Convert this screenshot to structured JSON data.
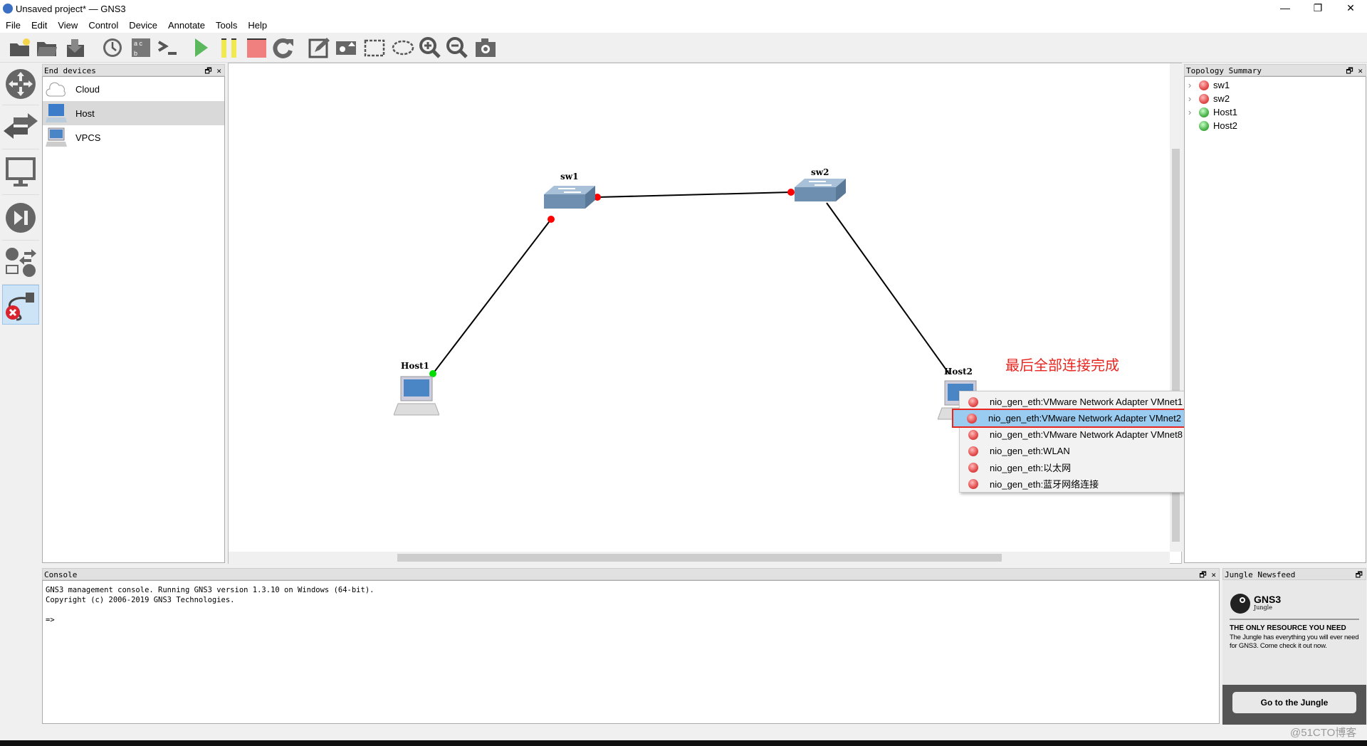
{
  "window": {
    "title": "Unsaved project* — GNS3",
    "minimize": "—",
    "restore": "❐",
    "close": "✕"
  },
  "menu": [
    "File",
    "Edit",
    "View",
    "Control",
    "Device",
    "Annotate",
    "Tools",
    "Help"
  ],
  "toolbar": [
    "new-project-icon",
    "open-project-icon",
    "save-project-icon",
    "snapshot-icon",
    "show-interface-labels-icon",
    "console-all-icon",
    "start-all-icon",
    "suspend-all-icon",
    "stop-all-icon",
    "reload-all-icon",
    "add-note-icon",
    "insert-picture-icon",
    "draw-rectangle-icon",
    "draw-ellipse-icon",
    "zoom-in-icon",
    "zoom-out-icon",
    "screenshot-icon"
  ],
  "colors": {
    "start": "#5cb85c",
    "suspend": "#f2e94e",
    "stop": "#f08080",
    "link": "#000000",
    "port_down": "#ff0000",
    "port_up": "#00dd00",
    "annotation": "#e8261f",
    "highlight": "#99ccf0"
  },
  "end_devices": {
    "title": "End devices",
    "items": [
      {
        "label": "Cloud"
      },
      {
        "label": "Host",
        "selected": true
      },
      {
        "label": "VPCS"
      }
    ]
  },
  "canvas": {
    "nodes": [
      {
        "label": "sw1"
      },
      {
        "label": "sw2"
      },
      {
        "label": "Host1"
      },
      {
        "label": "Host2"
      }
    ],
    "annotation": "最后全部连接完成"
  },
  "context_menu": {
    "items": [
      {
        "label": "nio_gen_eth:VMware Network Adapter VMnet1"
      },
      {
        "label": "nio_gen_eth:VMware Network Adapter VMnet2",
        "highlighted": true
      },
      {
        "label": "nio_gen_eth:VMware Network Adapter VMnet8"
      },
      {
        "label": "nio_gen_eth:WLAN"
      },
      {
        "label": "nio_gen_eth:以太网"
      },
      {
        "label": "nio_gen_eth:蓝牙网络连接"
      }
    ]
  },
  "topology": {
    "title": "Topology Summary",
    "items": [
      {
        "label": "sw1",
        "status": "red",
        "expandable": true
      },
      {
        "label": "sw2",
        "status": "red",
        "expandable": true
      },
      {
        "label": "Host1",
        "status": "green",
        "expandable": true
      },
      {
        "label": "Host2",
        "status": "green",
        "expandable": false
      }
    ]
  },
  "console": {
    "title": "Console",
    "lines": [
      "GNS3 management console. Running GNS3 version 1.3.10 on Windows (64-bit).",
      "Copyright (c) 2006-2019 GNS3 Technologies.",
      "",
      "=>"
    ]
  },
  "jungle": {
    "title": "Jungle Newsfeed",
    "logo": "GNS3",
    "logo_sub": "Jungle",
    "headline": "THE ONLY RESOURCE YOU NEED",
    "body": "The Jungle has everything you will ever need for GNS3. Come check it out now.",
    "button": "Go to the Jungle"
  },
  "watermark": "@51CTO博客",
  "panel_controls": {
    "float": "🗗",
    "close": "✕"
  }
}
